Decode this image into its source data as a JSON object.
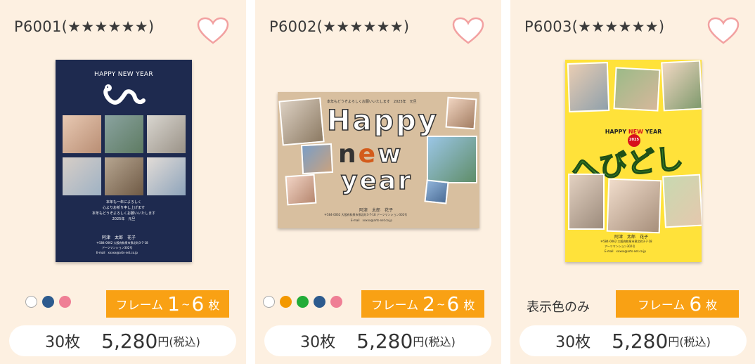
{
  "cards": [
    {
      "code": "P6001(★★★★★★)",
      "thumb": {
        "heading": "HAPPY NEW YEAR",
        "greeting": [
          "本年も一年によろしく",
          "心よりお祈り申し上げます",
          "本年もどうぞよろしくお願いいたします",
          "2025年　元旦"
        ],
        "name": "阿津　太郎　花子",
        "address": "〒584-0062 大阪府和泉市泉北町3-7-18",
        "building": "アーツマンション302号",
        "email": "E-mail　xxxxx@arts-net.co.jp"
      },
      "swatches": [
        "#ffffff",
        "#2d5b8e",
        "#ef7f95"
      ],
      "frame": {
        "prefix": "フレーム",
        "num1": "1",
        "tilde": "~",
        "num2": "6",
        "suffix": "枚"
      },
      "price": {
        "count": "30枚",
        "amount": "5,280",
        "unit": "円(税込)"
      }
    },
    {
      "code": "P6002(★★★★★★)",
      "thumb": {
        "top_line": "本年もどうぞよろしくお願いいたします　2025年　元旦",
        "big1": "Happy",
        "big2_a": "n",
        "big2_b": "e",
        "big2_c": "w",
        "big3": "year",
        "name": "阿津　太郎　花子",
        "address": "〒584-0062 大阪府和泉市泉北町3-7-18 アーツマンション302号",
        "email": "E-mail　xxxxx@arts-net.co.jp"
      },
      "swatches": [
        "#ffffff",
        "#f39800",
        "#22ac38",
        "#2d5b8e",
        "#ef7f95"
      ],
      "frame": {
        "prefix": "フレーム",
        "num1": "2",
        "tilde": "~",
        "num2": "6",
        "suffix": "枚"
      },
      "price": {
        "count": "30枚",
        "amount": "5,280",
        "unit": "円(税込)"
      }
    },
    {
      "code": "P6003(★★★★★★)",
      "thumb": {
        "heading_a": "HAPPY",
        "heading_b": "NEW",
        "heading_c": "YEAR",
        "year": "2025",
        "big": "へびどし",
        "name": "阿津　太郎　花子",
        "address": "〒584-0062 大阪府和泉市泉北町3-7-18",
        "building": "アーツマンション302号",
        "email": "E-mail　xxxxx@arts-net.co.jp"
      },
      "only_label": "表示色のみ",
      "frame": {
        "prefix": "フレーム",
        "num": "6",
        "suffix": "枚"
      },
      "price": {
        "count": "30枚",
        "amount": "5,280",
        "unit": "円(税込)"
      }
    }
  ]
}
